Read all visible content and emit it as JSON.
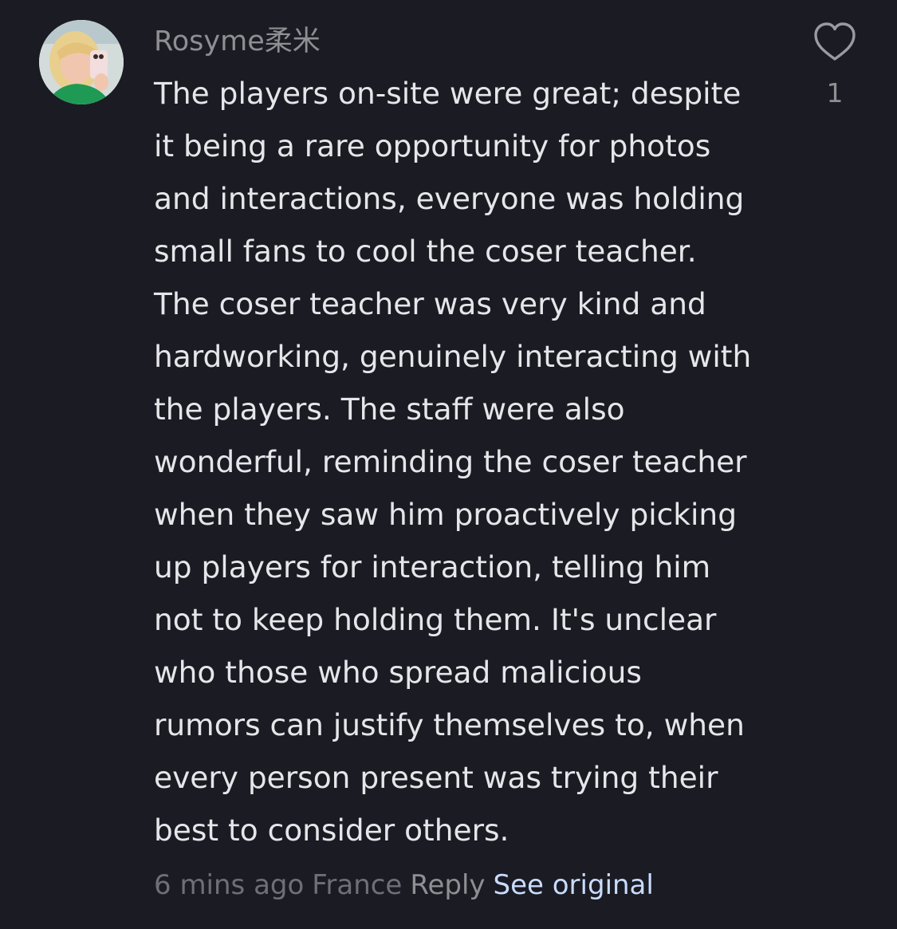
{
  "comment": {
    "username": "Rosyme柔米",
    "body_lines": [
      "The players on-site were great; despite",
      "it being a rare opportunity for photos",
      "and interactions, everyone was holding",
      "small fans to cool the coser teacher.",
      "The coser teacher was very kind and",
      "hardworking, genuinely interacting with",
      "the players. The staff were also",
      "wonderful, reminding the coser teacher",
      "when they saw him proactively picking",
      "up players for interaction, telling him",
      "not to keep holding them. It's unclear",
      "who those who spread malicious",
      "rumors can justify themselves to, when",
      "every person present was trying their",
      "best to consider others."
    ],
    "like_count": "1",
    "timestamp": "6 mins ago",
    "location": "France",
    "reply_label": "Reply",
    "see_original_label": "See original"
  },
  "colors": {
    "background": "#1b1b23",
    "body_text": "#e6e6ea",
    "muted_text": "#8e8e93",
    "link": "#c9dcff"
  },
  "icons": {
    "avatar": "user-avatar-photo",
    "like": "heart-outline-icon"
  }
}
